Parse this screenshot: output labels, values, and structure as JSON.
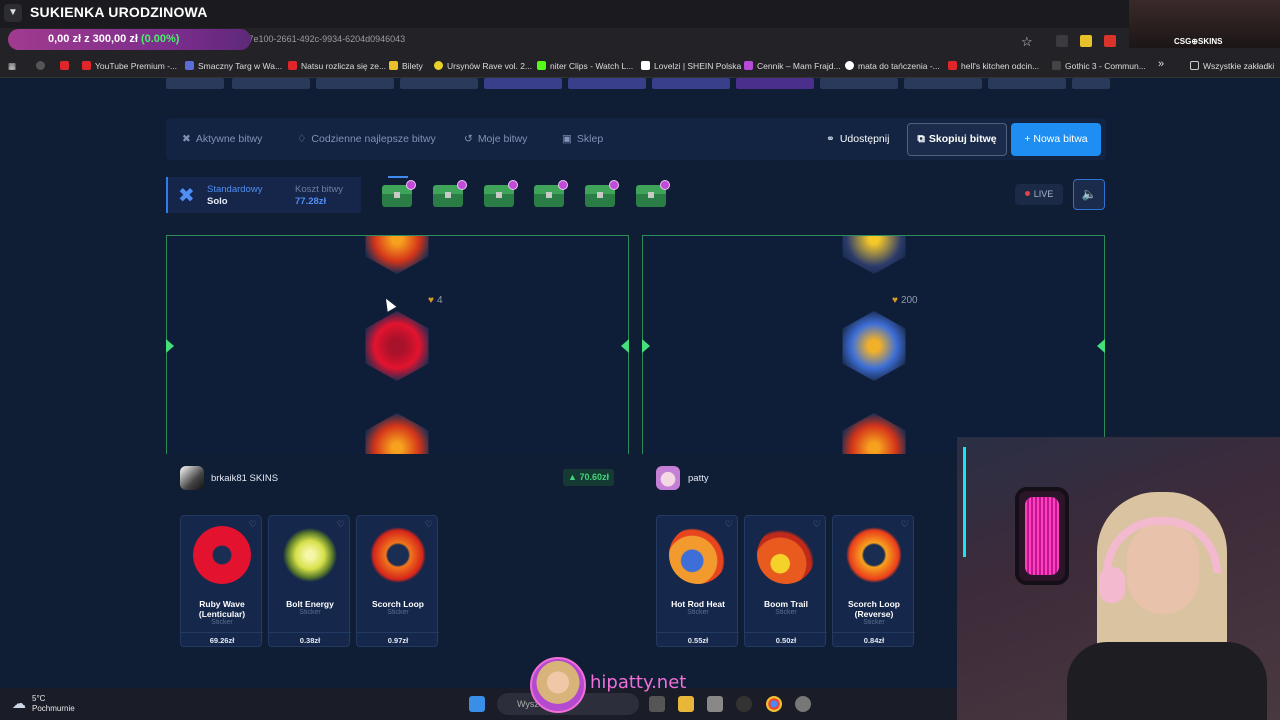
{
  "stream": {
    "title": "SUKIENKA URODZINOWA",
    "brand_name": "hipatty.net",
    "sponsor_logo": "CSG⊕SKINS"
  },
  "browser": {
    "url": "attle/be27e100-2661-492c-9934-6204d0946043",
    "balance_text": "0,00 zł z 300,00 zł",
    "balance_pct": "(0.00%)",
    "bookmarks": [
      "YouTube Premium -...",
      "Smaczny Targ w Wa...",
      "Natsu rozlicza się ze...",
      "Bilety",
      "Ursynów Rave vol. 2...",
      "niter Clips - Watch L...",
      "Lovelzi | SHEIN Polska",
      "Cennik – Mam Frajd...",
      "mata do tańczenia -...",
      "hell's kitchen odcin...",
      "Gothic 3 - Commun...",
      "»",
      "Wszystkie zakładki"
    ]
  },
  "nav": {
    "active_battles": "Aktywne bitwy",
    "daily_best": "Codzienne najlepsze bitwy",
    "my_battles": "Moje bitwy",
    "shop": "Sklep",
    "share": "Udostępnij",
    "copy_battle": "Skopiuj bitwę",
    "new_battle": "+ Nowa bitwa"
  },
  "mode": {
    "label": "Standardowy",
    "value": "Solo",
    "cost_label": "Koszt bitwy",
    "cost_value": "77.28zł",
    "case_count": 6
  },
  "live_label": "LIVE",
  "reels": [
    {
      "quantity": "4"
    },
    {
      "quantity": "200"
    }
  ],
  "players": [
    {
      "name": "brkaik81 SKINS",
      "total": "70.60zł",
      "items": [
        {
          "name": "Ruby Wave (Lenticular)",
          "type": "Sticker",
          "price": "69.26zł",
          "color": "#e3132f"
        },
        {
          "name": "Bolt Energy",
          "type": "Sticker",
          "price": "0.38zł",
          "color": "#d6e04a"
        },
        {
          "name": "Scorch Loop",
          "type": "Sticker",
          "price": "0.97zł",
          "color": "#f0761d"
        }
      ]
    },
    {
      "name": "patty",
      "items": [
        {
          "name": "Hot Rod Heat",
          "type": "Sticker",
          "price": "0.55zł",
          "color": "#f29a2e"
        },
        {
          "name": "Boom Trail",
          "type": "Sticker",
          "price": "0.50zł",
          "color": "#e85a1e"
        },
        {
          "name": "Scorch Loop (Reverse)",
          "type": "Sticker",
          "price": "0.84zł",
          "color": "#ea3d1b"
        }
      ]
    }
  ],
  "taskbar": {
    "temp": "5°C",
    "weather": "Pochmurnie",
    "search": "Wysz"
  }
}
